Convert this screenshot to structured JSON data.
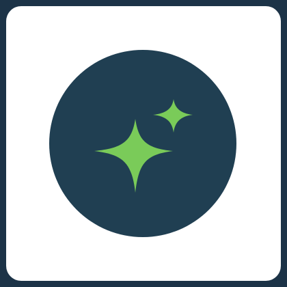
{
  "app_icon": {
    "icon": "sparkles-icon",
    "colors": {
      "frame": "#1c3347",
      "tile": "#ffffff",
      "badge": "#203f52",
      "sparkle": "#7acb59"
    }
  }
}
